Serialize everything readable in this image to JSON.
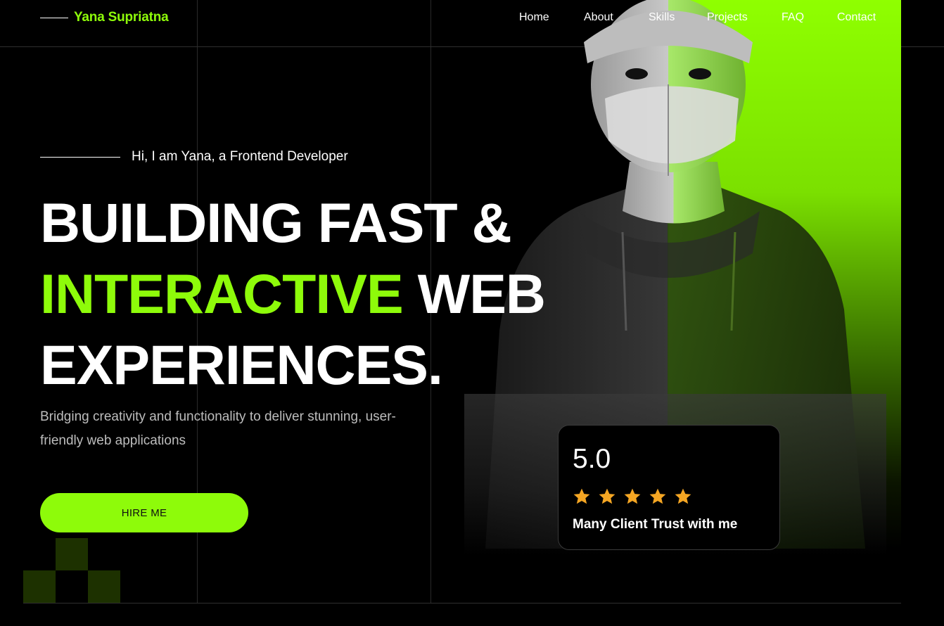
{
  "header": {
    "logo": "Yana Supriatna",
    "nav": [
      "Home",
      "About",
      "Skills",
      "Projects",
      "FAQ",
      "Contact"
    ]
  },
  "hero": {
    "intro": "Hi, I am Yana, a Frontend Developer",
    "headline": {
      "line1": "BUILDING FAST &",
      "line2_accent": "INTERACTIVE",
      "line2_rest": " WEB",
      "line3": "EXPERIENCES."
    },
    "subtitle": "Bridging creativity and functionality to deliver stunning, user-friendly web applications",
    "cta_label": "HIRE ME"
  },
  "rating": {
    "score": "5.0",
    "stars": 5,
    "caption": "Many Client Trust with me"
  },
  "colors": {
    "accent": "#8efb0a",
    "background": "#000000",
    "star": "#f5a623"
  },
  "icons": [
    "star-icon",
    "portrait-image"
  ]
}
